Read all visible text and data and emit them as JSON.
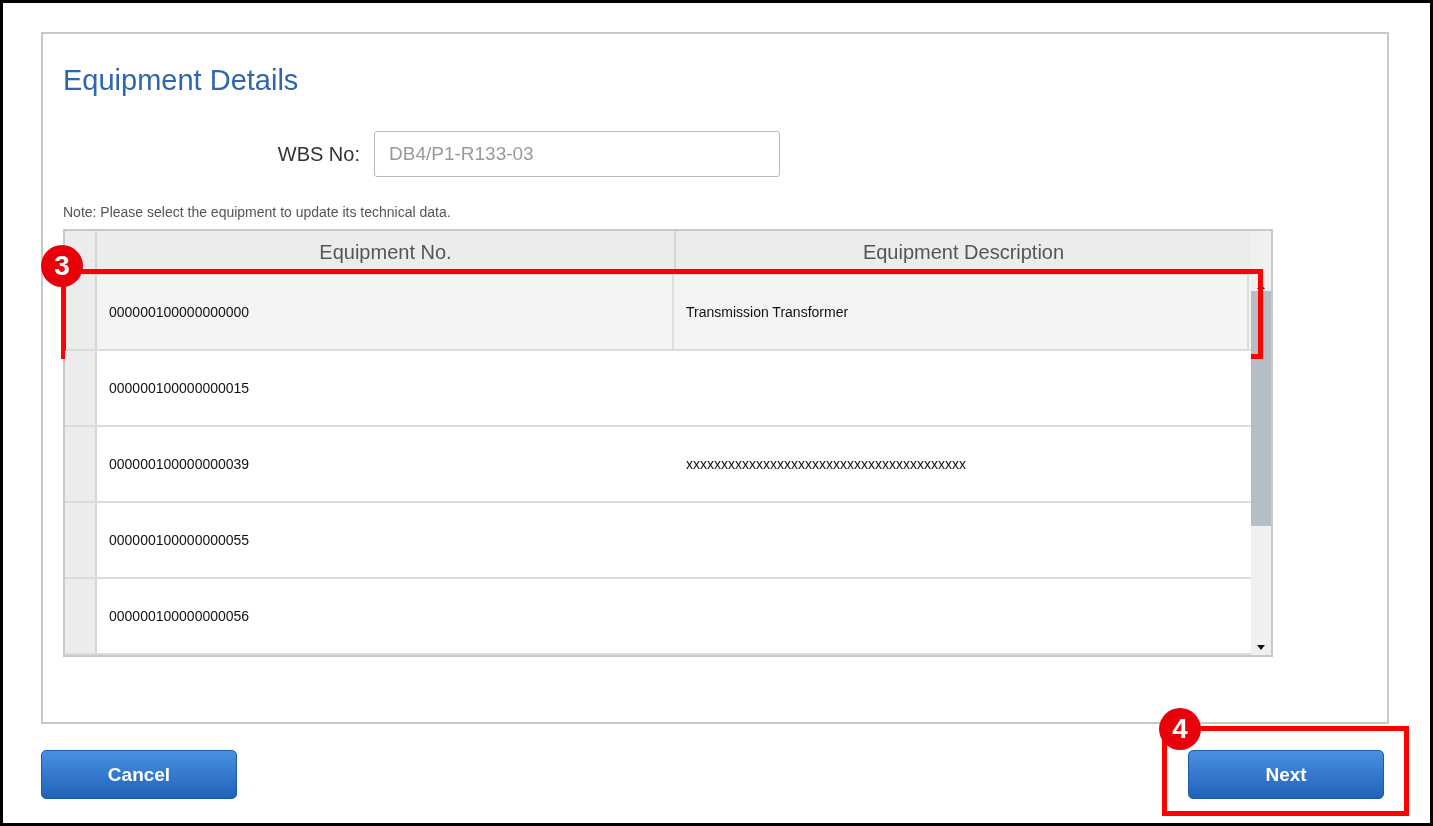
{
  "title": "Equipment Details",
  "wbs": {
    "label": "WBS No:",
    "value": "DB4/P1-R133-03"
  },
  "note": "Note: Please select the equipment to update its technical data.",
  "table": {
    "columns": [
      "Equipment No.",
      "Equipment Description"
    ],
    "rows": [
      {
        "number": "000000100000000000",
        "description": "Transmission Transformer",
        "selected": true,
        "callout": "3"
      },
      {
        "number": "000000100000000015",
        "selected": false
      },
      {
        "number": "000000100000000039",
        "description": "xxxxxxxxxxxxxxxxxxxxxxxxxxxxxxxxxxxxxxxx",
        "selected": false
      },
      {
        "number": "000000100000000055",
        "selected": false
      },
      {
        "number": "000000100000000056",
        "selected": false
      }
    ]
  },
  "buttons": [
    {
      "label": "Cancel"
    },
    {
      "label": "Next",
      "callout": "4"
    }
  ]
}
